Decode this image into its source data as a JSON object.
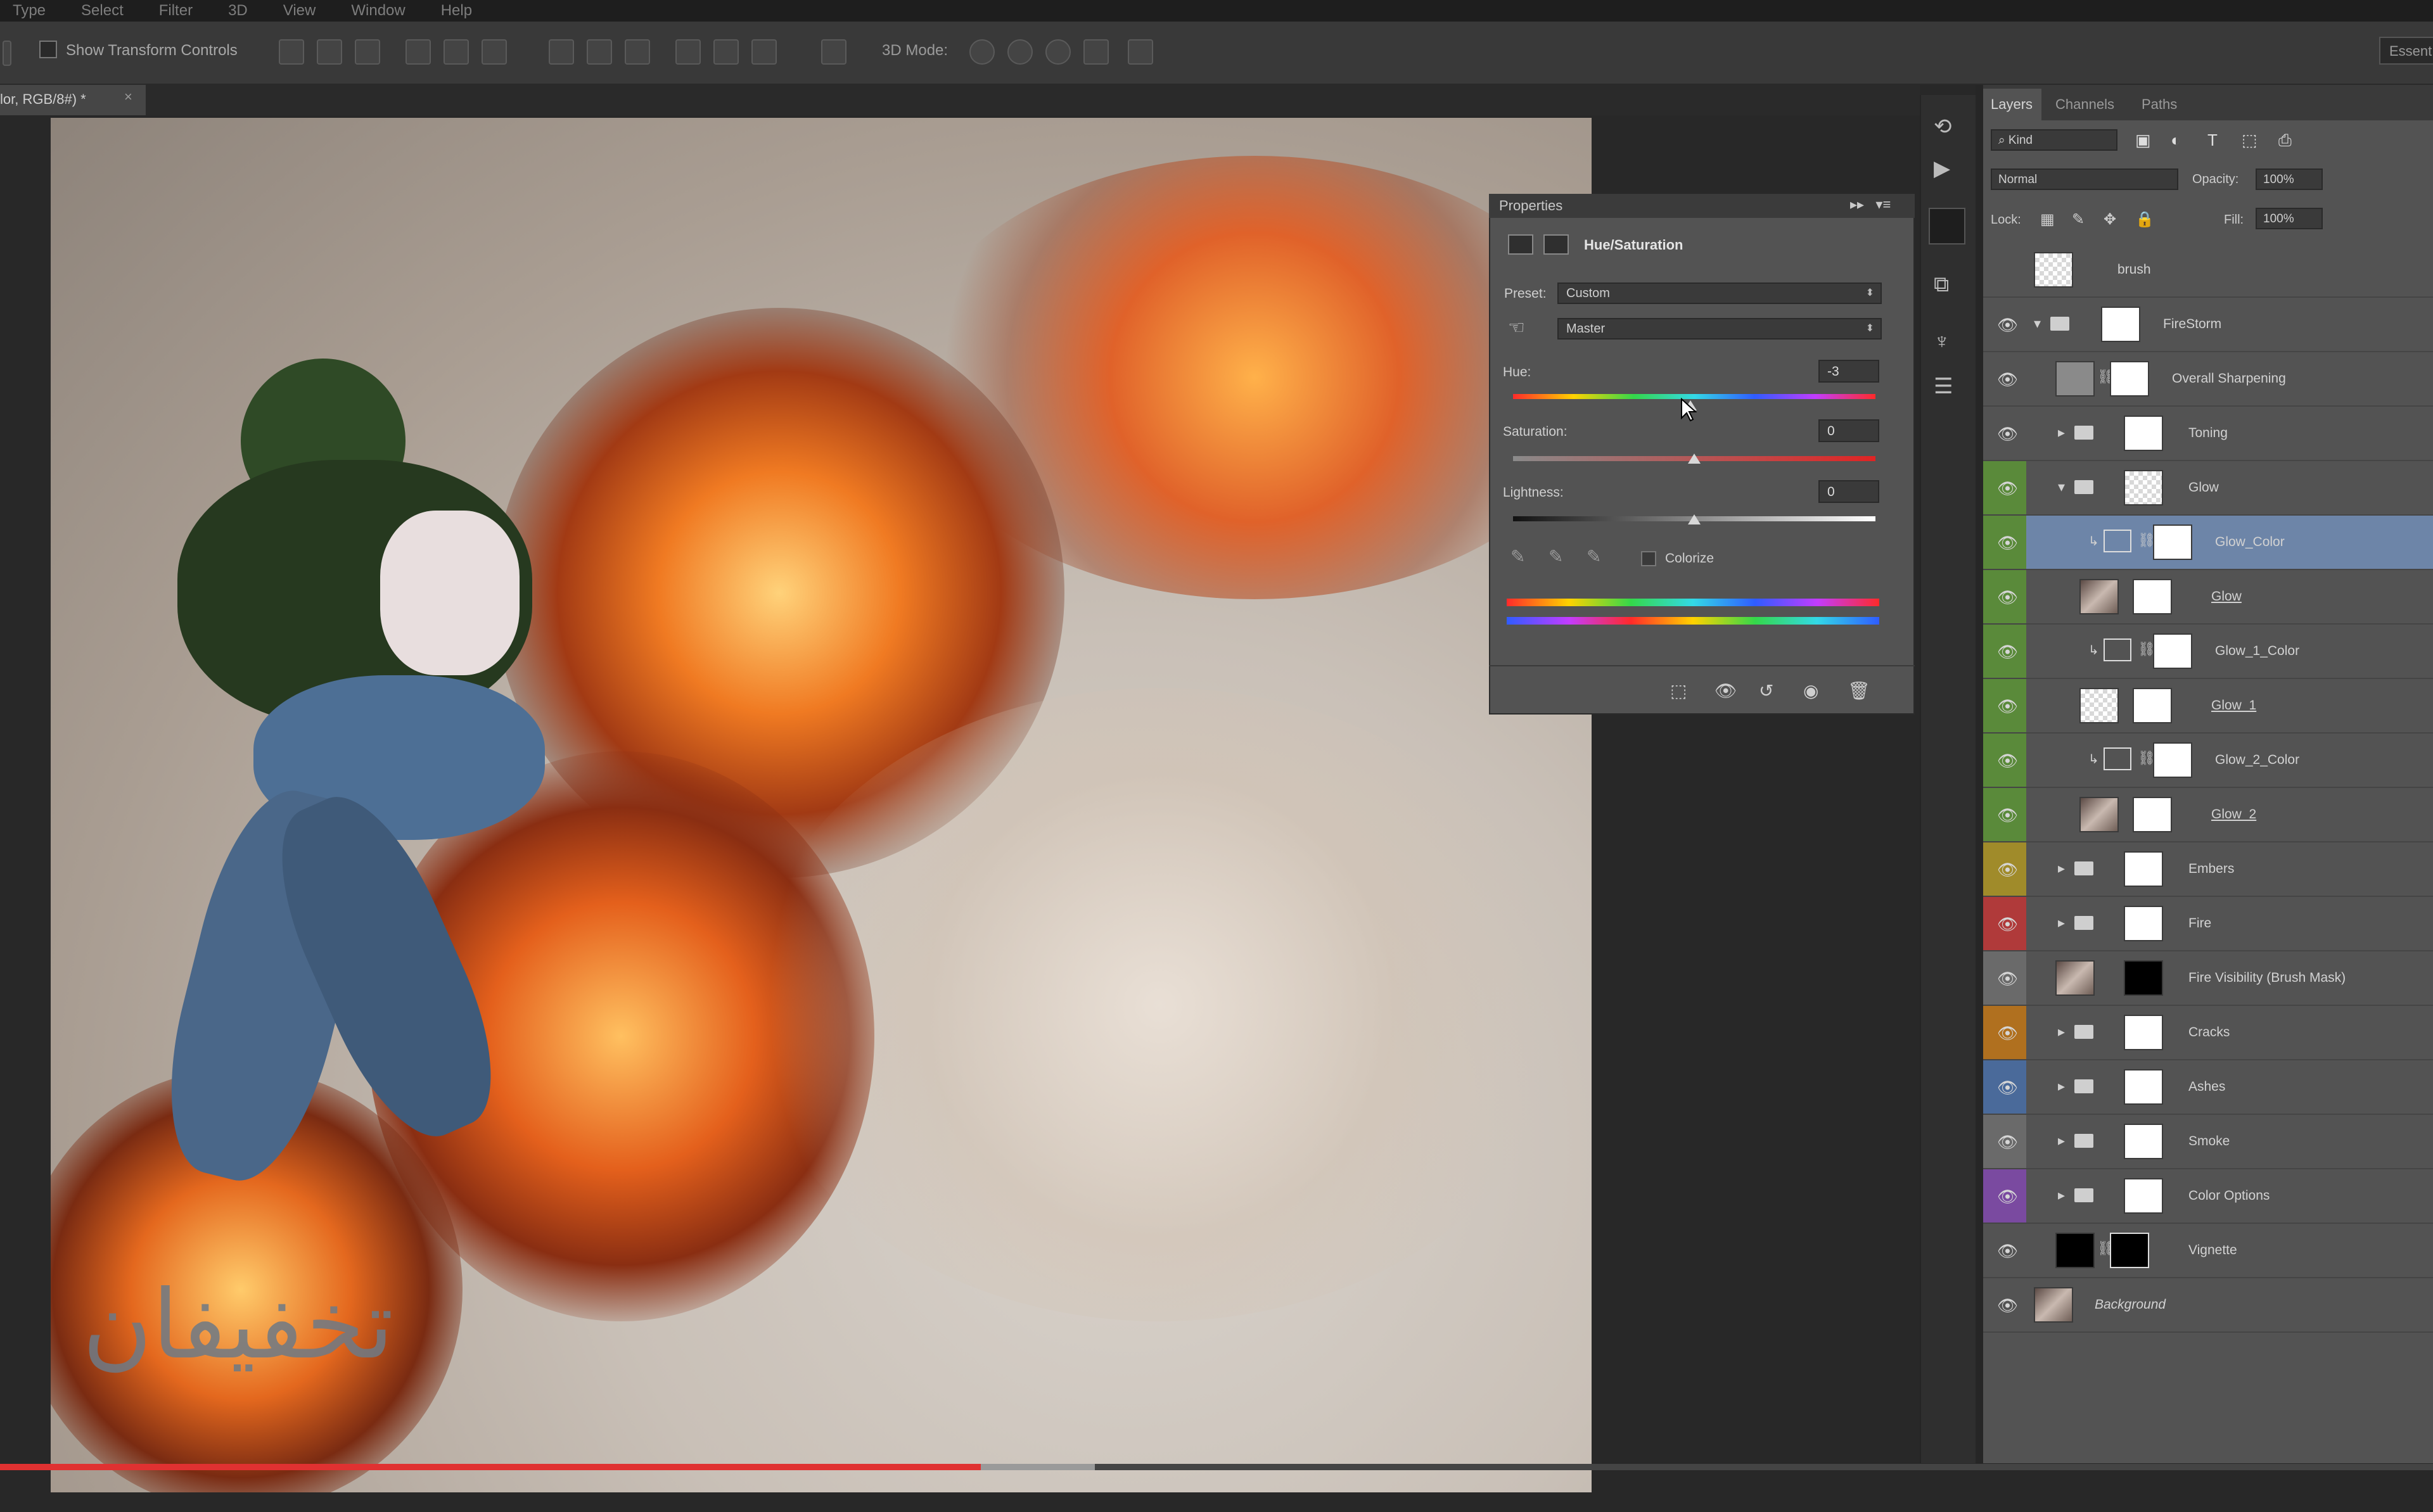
{
  "menu": [
    "Type",
    "Select",
    "Filter",
    "3D",
    "View",
    "Window",
    "Help"
  ],
  "options_bar": {
    "show_transform_controls": "Show Transform Controls",
    "mode_3d": "3D Mode:",
    "workspace": "Essent"
  },
  "document_tab": {
    "title": "lor, RGB/8#) *",
    "close": "×"
  },
  "watermark": "تخفيفان",
  "progress": {
    "played_fraction": 0.403,
    "buffered_fraction": 0.45
  },
  "properties": {
    "title": "Properties",
    "panel_title": "Hue/Saturation",
    "preset_label": "Preset:",
    "preset_value": "Custom",
    "channel_value": "Master",
    "hue_label": "Hue:",
    "hue_value": "-3",
    "saturation_label": "Saturation:",
    "saturation_value": "0",
    "lightness_label": "Lightness:",
    "lightness_value": "0",
    "colorize_label": "Colorize",
    "hue_thumb_fraction": 0.49,
    "sat_thumb_fraction": 0.5,
    "light_thumb_fraction": 0.5
  },
  "layers_panel": {
    "tabs": [
      "Layers",
      "Channels",
      "Paths"
    ],
    "filter_kind": "Kind",
    "blend_mode": "Normal",
    "opacity_label": "Opacity:",
    "opacity_value": "100%",
    "lock_label": "Lock:",
    "fill_label": "Fill:",
    "fill_value": "100%",
    "layers": [
      {
        "name": "brush",
        "visible": false,
        "color": "#535353",
        "italic": false
      },
      {
        "name": "FireStorm",
        "visible": true,
        "color": "#535353",
        "italic": false
      },
      {
        "name": "Overall Sharpening",
        "visible": true,
        "color": "#535353",
        "italic": false
      },
      {
        "name": "Toning",
        "visible": true,
        "color": "#535353",
        "italic": false
      },
      {
        "name": "Glow",
        "visible": true,
        "color": "#5a8a3a",
        "italic": false
      },
      {
        "name": "Glow_Color",
        "visible": true,
        "color": "#5a8a3a",
        "italic": false
      },
      {
        "name": "Glow",
        "visible": true,
        "color": "#5a8a3a",
        "italic": false
      },
      {
        "name": "Glow_1_Color",
        "visible": true,
        "color": "#5a8a3a",
        "italic": false
      },
      {
        "name": "Glow_1",
        "visible": true,
        "color": "#5a8a3a",
        "italic": false
      },
      {
        "name": "Glow_2_Color",
        "visible": true,
        "color": "#5a8a3a",
        "italic": false
      },
      {
        "name": "Glow_2",
        "visible": true,
        "color": "#5a8a3a",
        "italic": false
      },
      {
        "name": "Embers",
        "visible": true,
        "color": "#a08b2a",
        "italic": false
      },
      {
        "name": "Fire",
        "visible": true,
        "color": "#b03a3a",
        "italic": false
      },
      {
        "name": "Fire Visibility (Brush Mask)",
        "visible": true,
        "color": "#6a6a6a",
        "italic": false
      },
      {
        "name": "Cracks",
        "visible": true,
        "color": "#b0701f",
        "italic": false
      },
      {
        "name": "Ashes",
        "visible": true,
        "color": "#4a6a9a",
        "italic": false
      },
      {
        "name": "Smoke",
        "visible": true,
        "color": "#6a6a6a",
        "italic": false
      },
      {
        "name": "Color Options",
        "visible": true,
        "color": "#7a4aa0",
        "italic": false
      },
      {
        "name": "Vignette",
        "visible": true,
        "color": "#535353",
        "italic": false
      },
      {
        "name": "Background",
        "visible": true,
        "color": "#535353",
        "italic": true
      }
    ]
  },
  "colors": {
    "progress_played": "#e03131",
    "selected_layer": "#6d85a8",
    "panel_bg": "#535353"
  }
}
